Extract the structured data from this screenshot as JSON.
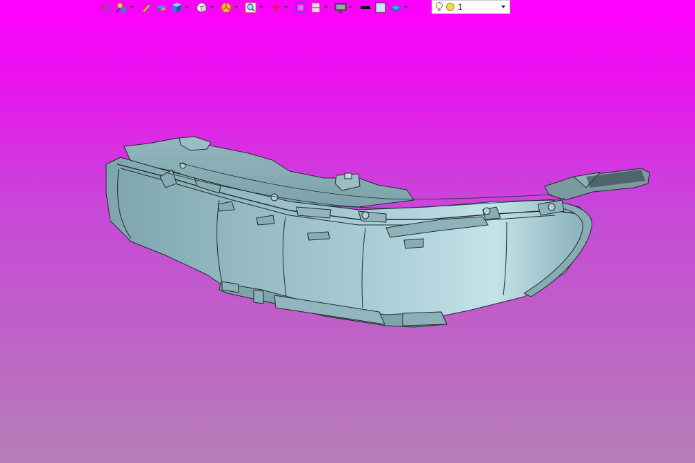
{
  "window": {
    "background_top": "#ff00ff",
    "background_bottom": "#b67fb8"
  },
  "toolbar": {
    "icons": [
      "exit-sketch-icon",
      "sketch-constraint-icon",
      "pencil-icon",
      "extrude-icon",
      "cube-view-icon",
      "wireframe-cube-icon",
      "section-pie-icon",
      "zoom-icon",
      "axis-icon",
      "fit-view-icon",
      "clipping-plane-icon",
      "display-monitor-icon",
      "line-style-icon",
      "fill-color-icon",
      "layer-icon",
      "lightbulb-icon"
    ],
    "render_mode_value": "1"
  },
  "model": {
    "name": "headlamp-housing",
    "surface_color": "#8fb3bb",
    "edge_color": "#1e2a2c"
  }
}
